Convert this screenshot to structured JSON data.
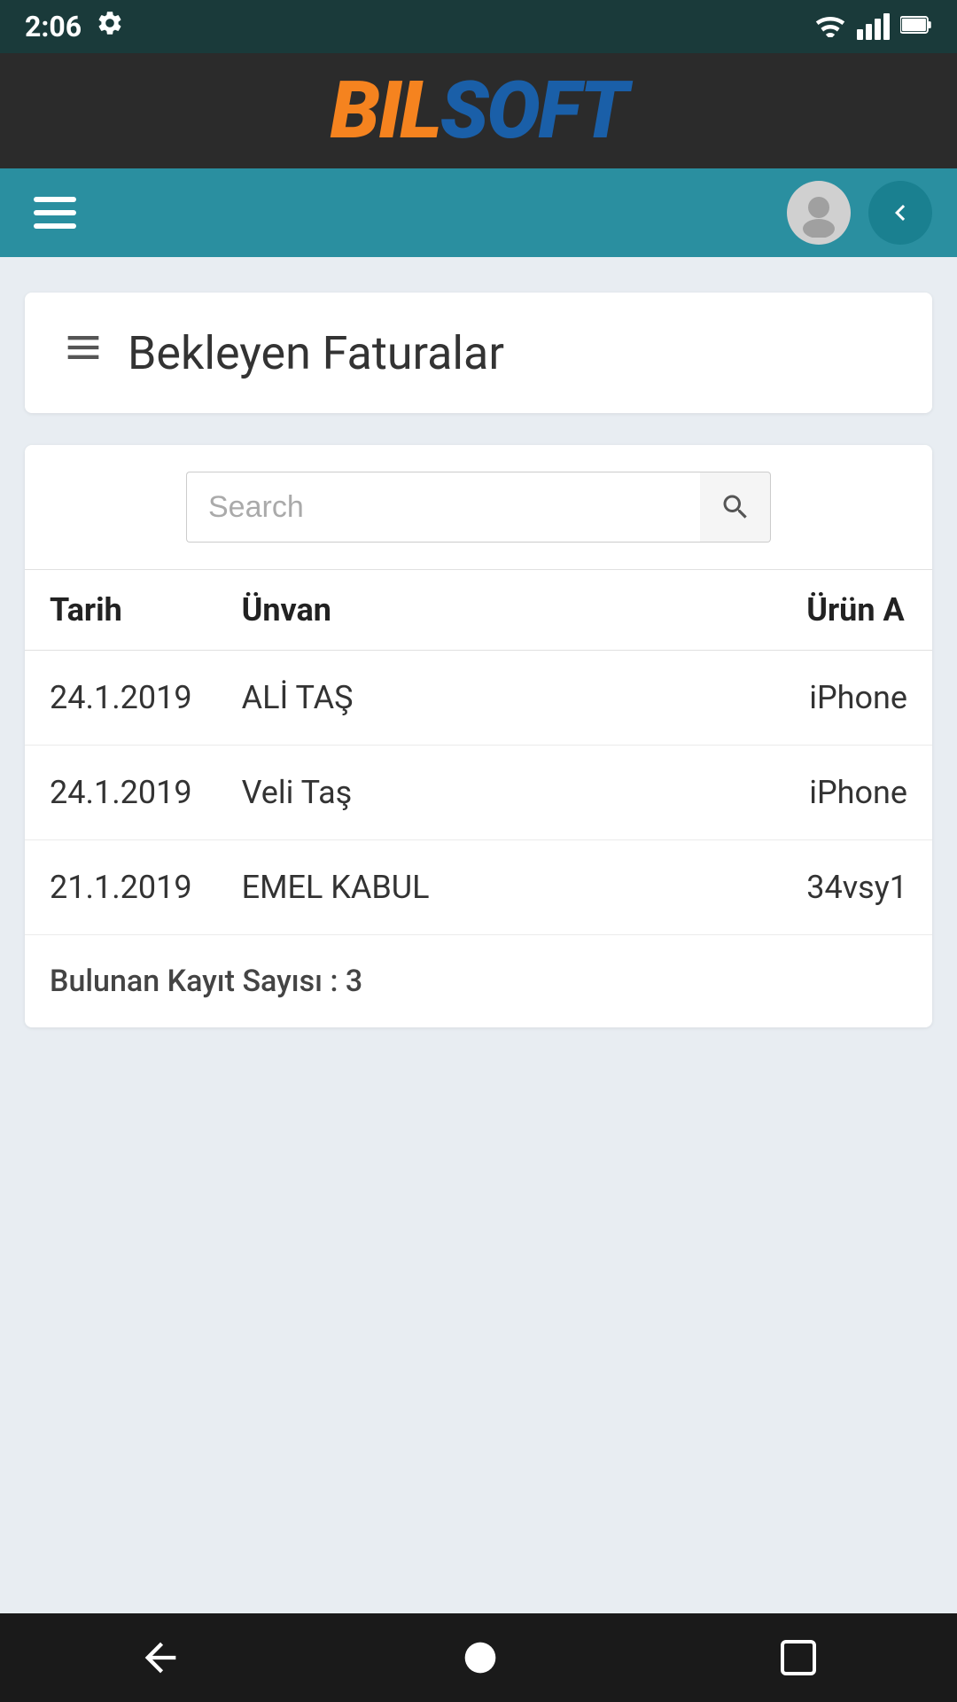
{
  "statusBar": {
    "time": "2:06",
    "settingsIcon": "gear-icon"
  },
  "logo": {
    "bil": "BIL",
    "soft": "SOFT"
  },
  "navBar": {
    "hamburgerLabel": "menu",
    "backLabel": "back"
  },
  "pageTitle": {
    "icon": "≡",
    "title": "Bekleyen Faturalar"
  },
  "search": {
    "placeholder": "Search",
    "buttonLabel": "search"
  },
  "table": {
    "columns": [
      {
        "key": "tarih",
        "label": "Tarih"
      },
      {
        "key": "unvan",
        "label": "Ünvan"
      },
      {
        "key": "urun",
        "label": "Ürün A"
      }
    ],
    "rows": [
      {
        "tarih": "24.1.2019",
        "unvan": "ALİ TAŞ",
        "urun": "iPhone"
      },
      {
        "tarih": "24.1.2019",
        "unvan": "Veli Taş",
        "urun": "iPhone"
      },
      {
        "tarih": "21.1.2019",
        "unvan": "EMEL KABUL",
        "urun": "34vsy1"
      }
    ],
    "footer": "Bulunan Kayıt Sayısı : 3"
  }
}
